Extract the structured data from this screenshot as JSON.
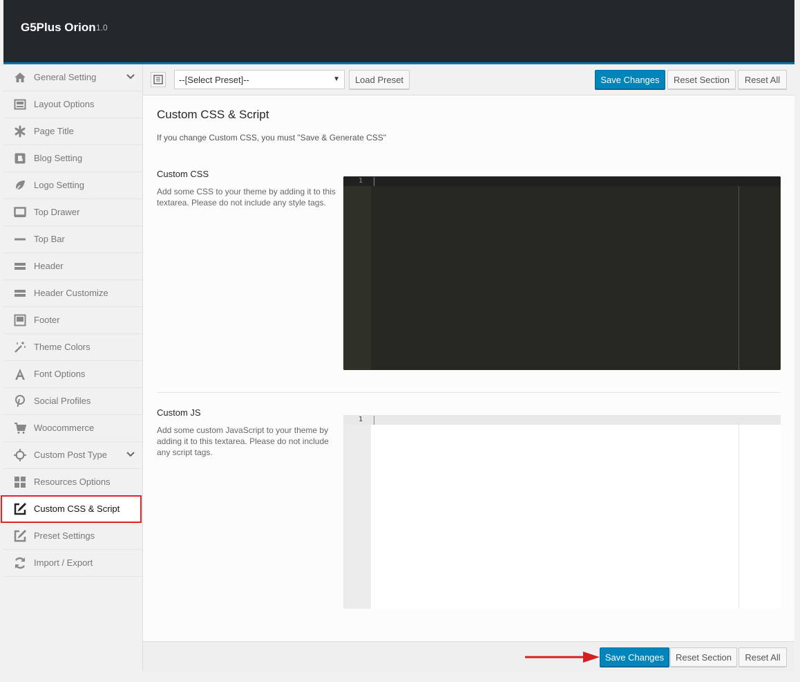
{
  "app": {
    "title": "G5Plus Orion",
    "version": "1.0"
  },
  "sidebar": {
    "items": [
      {
        "label": "General Setting",
        "icon": "home-icon",
        "has_children": true
      },
      {
        "label": "Layout Options",
        "icon": "layout-icon",
        "has_children": false
      },
      {
        "label": "Page Title",
        "icon": "asterisk-icon",
        "has_children": false
      },
      {
        "label": "Blog Setting",
        "icon": "blog-icon",
        "has_children": false
      },
      {
        "label": "Logo Setting",
        "icon": "leaf-icon",
        "has_children": false
      },
      {
        "label": "Top Drawer",
        "icon": "monitor-icon",
        "has_children": false
      },
      {
        "label": "Top Bar",
        "icon": "minus-icon",
        "has_children": false
      },
      {
        "label": "Header",
        "icon": "header-icon",
        "has_children": false
      },
      {
        "label": "Header Customize",
        "icon": "header-customize-icon",
        "has_children": false
      },
      {
        "label": "Footer",
        "icon": "footer-icon",
        "has_children": false
      },
      {
        "label": "Theme Colors",
        "icon": "magic-wand-icon",
        "has_children": false
      },
      {
        "label": "Font Options",
        "icon": "font-icon",
        "has_children": false
      },
      {
        "label": "Social Profiles",
        "icon": "pinterest-icon",
        "has_children": false
      },
      {
        "label": "Woocommerce",
        "icon": "cart-icon",
        "has_children": false
      },
      {
        "label": "Custom Post Type",
        "icon": "crosshair-icon",
        "has_children": true
      },
      {
        "label": "Resources Options",
        "icon": "grid-icon",
        "has_children": false
      },
      {
        "label": "Custom CSS & Script",
        "icon": "edit-icon",
        "has_children": false,
        "active": true
      },
      {
        "label": "Preset Settings",
        "icon": "edit-icon",
        "has_children": false
      },
      {
        "label": "Import / Export",
        "icon": "refresh-icon",
        "has_children": false
      }
    ]
  },
  "toolbar": {
    "preset_placeholder": "--[Select Preset]--",
    "load_preset": "Load Preset",
    "save_changes": "Save Changes",
    "reset_section": "Reset Section",
    "reset_all": "Reset All"
  },
  "section": {
    "title": "Custom CSS & Script",
    "description": "If you change Custom CSS, you must \"Save & Generate CSS\""
  },
  "fields": {
    "custom_css": {
      "title": "Custom CSS",
      "description": "Add some CSS to your theme by adding it to this textarea. Please do not include any style tags.",
      "line_number": "1"
    },
    "custom_js": {
      "title": "Custom JS",
      "description": "Add some custom JavaScript to your theme by adding it to this textarea. Please do not include any script tags.",
      "line_number": "1"
    }
  },
  "footer": {
    "save_changes": "Save Changes",
    "reset_section": "Reset Section",
    "reset_all": "Reset All"
  },
  "colors": {
    "primary": "#0085ba",
    "header_bg": "#23282d",
    "highlight": "#e02424"
  }
}
